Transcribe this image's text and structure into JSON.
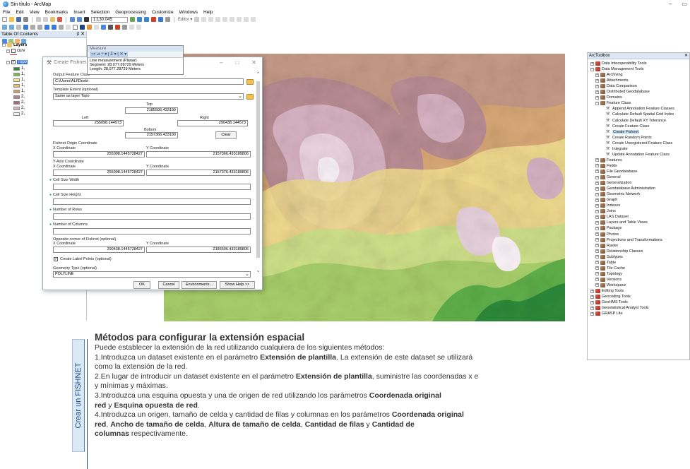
{
  "window": {
    "title": "Sin título - ArcMap",
    "controls": [
      "–",
      "▭"
    ]
  },
  "menu": [
    "File",
    "Edit",
    "View",
    "Bookmarks",
    "Insert",
    "Selection",
    "Geoprocessing",
    "Customize",
    "Windows",
    "Help"
  ],
  "toolbar": {
    "scale": "1:130.045",
    "editor_label": "Editor ▾"
  },
  "toc": {
    "title": "Table Of Contents",
    "pin": "♯",
    "close": "✕",
    "root_label": "Layers",
    "layer1_label": "curv",
    "layer2_label": "Topo",
    "class_labels": [
      "1,",
      "1,",
      "1,",
      "1,",
      "1,",
      "2,",
      "2,",
      "2,",
      "2,"
    ],
    "class_colors": [
      "#2e8b3a",
      "#7fbf4f",
      "#f0e68c",
      "#e8c26a",
      "#d4a373",
      "#b5838d",
      "#a16a7a",
      "#d7b8c6",
      "#f2f2f2"
    ]
  },
  "measure": {
    "title": "Measure",
    "tools": "⊶ ⊿ ÷ ▾ | Σ ▾ | ✕ ▾",
    "lines": [
      "Line measurement (Planar)",
      "Segment: 28,077.28729 Meters",
      "Length: 28,077.28729 Meters"
    ]
  },
  "dialog": {
    "title": "Create Fishnet",
    "win_min": "–",
    "win_max": "□",
    "win_close": "✕",
    "output_label": "Output Feature Class",
    "output_value": "C:\\Users\\ALI\\Deskt",
    "template_label": "Template Extent (optional)",
    "template_value": "Same as layer Topo",
    "top_label": "Top",
    "top_value": "2185506.433190",
    "left_label": "Left",
    "left_value": "255098.144573",
    "right_label": "Right",
    "right_value": "290438.144573",
    "bottom_label": "Bottom",
    "bottom_value": "2157366.433190",
    "clear_label": "Clear",
    "origin_label": "Fishnet Origin Coordinate",
    "x_label": "X Coordinate",
    "y_label": "Y Coordinate",
    "origin_x": "255098.1445728427",
    "origin_y": "2157366.433189806",
    "yaxis_label": "Y-Axis Coordinate",
    "yaxis_x": "255098.1445728427",
    "yaxis_y": "2157376.433189806",
    "cell_width_label": "Cell Size Width",
    "cell_height_label": "Cell Size Height",
    "rows_label": "Number of Rows",
    "cols_label": "Number of Columns",
    "opposite_label": "Opposite corner of Fishnet (optional)",
    "opposite_x": "290438.1445728427",
    "opposite_y": "2185506.433189806",
    "label_points": "Create Label Points (optional)",
    "geometry_label": "Geometry Type (optional)",
    "geometry_value": "POLYLINE",
    "ok": "OK",
    "cancel": "Cancel",
    "environments": "Environments...",
    "help": "Show Help >>"
  },
  "arctoolbox": {
    "title": "ArcToolbox",
    "items": [
      {
        "text": "Data Interoperability Tools",
        "level": 0,
        "kind": "box",
        "exp": "+"
      },
      {
        "text": "Data Management Tools",
        "level": 0,
        "kind": "box",
        "exp": "−"
      },
      {
        "text": "Archiving",
        "level": 1,
        "kind": "set",
        "exp": "+"
      },
      {
        "text": "Attachments",
        "level": 1,
        "kind": "set",
        "exp": "+"
      },
      {
        "text": "Data Comparison",
        "level": 1,
        "kind": "set",
        "exp": "+"
      },
      {
        "text": "Distributed Geodatabase",
        "level": 1,
        "kind": "set",
        "exp": "+"
      },
      {
        "text": "Domains",
        "level": 1,
        "kind": "set",
        "exp": "+"
      },
      {
        "text": "Feature Class",
        "level": 1,
        "kind": "set",
        "exp": "−"
      },
      {
        "text": "Append Annotation Feature Classes",
        "level": 2,
        "kind": "tool"
      },
      {
        "text": "Calculate Default Spatial Grid Index",
        "level": 2,
        "kind": "tool"
      },
      {
        "text": "Calculate Default XY Tolerance",
        "level": 2,
        "kind": "tool"
      },
      {
        "text": "Create Feature Class",
        "level": 2,
        "kind": "tool"
      },
      {
        "text": "Create Fishnet",
        "level": 2,
        "kind": "tool",
        "selected": true
      },
      {
        "text": "Create Random Points",
        "level": 2,
        "kind": "tool"
      },
      {
        "text": "Create Unregistered Feature Class",
        "level": 2,
        "kind": "tool"
      },
      {
        "text": "Integrate",
        "level": 2,
        "kind": "tool"
      },
      {
        "text": "Update Annotation Feature Class",
        "level": 2,
        "kind": "tool"
      },
      {
        "text": "Features",
        "level": 1,
        "kind": "set",
        "exp": "+"
      },
      {
        "text": "Fields",
        "level": 1,
        "kind": "set",
        "exp": "+"
      },
      {
        "text": "File Geodatabase",
        "level": 1,
        "kind": "set",
        "exp": "+"
      },
      {
        "text": "General",
        "level": 1,
        "kind": "set",
        "exp": "+"
      },
      {
        "text": "Generalization",
        "level": 1,
        "kind": "set",
        "exp": "+"
      },
      {
        "text": "Geodatabase Administration",
        "level": 1,
        "kind": "set",
        "exp": "+"
      },
      {
        "text": "Geometric Network",
        "level": 1,
        "kind": "set",
        "exp": "+"
      },
      {
        "text": "Graph",
        "level": 1,
        "kind": "set",
        "exp": "+"
      },
      {
        "text": "Indexes",
        "level": 1,
        "kind": "set",
        "exp": "+"
      },
      {
        "text": "Joins",
        "level": 1,
        "kind": "set",
        "exp": "+"
      },
      {
        "text": "LAS Dataset",
        "level": 1,
        "kind": "set",
        "exp": "+"
      },
      {
        "text": "Layers and Table Views",
        "level": 1,
        "kind": "set",
        "exp": "+"
      },
      {
        "text": "Package",
        "level": 1,
        "kind": "set",
        "exp": "+"
      },
      {
        "text": "Photos",
        "level": 1,
        "kind": "set",
        "exp": "+"
      },
      {
        "text": "Projections and Transformations",
        "level": 1,
        "kind": "set",
        "exp": "+"
      },
      {
        "text": "Raster",
        "level": 1,
        "kind": "set",
        "exp": "+"
      },
      {
        "text": "Relationship Classes",
        "level": 1,
        "kind": "set",
        "exp": "+"
      },
      {
        "text": "Subtypes",
        "level": 1,
        "kind": "set",
        "exp": "+"
      },
      {
        "text": "Table",
        "level": 1,
        "kind": "set",
        "exp": "+"
      },
      {
        "text": "Tile Cache",
        "level": 1,
        "kind": "set",
        "exp": "+"
      },
      {
        "text": "Topology",
        "level": 1,
        "kind": "set",
        "exp": "+"
      },
      {
        "text": "Versions",
        "level": 1,
        "kind": "set",
        "exp": "+"
      },
      {
        "text": "Workspace",
        "level": 1,
        "kind": "set",
        "exp": "+"
      },
      {
        "text": "Editing Tools",
        "level": 0,
        "kind": "box",
        "exp": "+"
      },
      {
        "text": "Geocoding Tools",
        "level": 0,
        "kind": "box",
        "exp": "+"
      },
      {
        "text": "GeoHMS Tools",
        "level": 0,
        "kind": "box",
        "exp": "+"
      },
      {
        "text": "Geostatistical Analyst Tools",
        "level": 0,
        "kind": "box",
        "exp": "+"
      },
      {
        "text": "GRASP Lite",
        "level": 0,
        "kind": "box",
        "exp": "+"
      }
    ]
  },
  "annotation": {
    "side_label": "Crear un FISHNET",
    "title": "Métodos para configurar la extensión espacial",
    "intro": "Puede establecer la extensión de la red utilizando cualquiera de los siguientes métodos:",
    "m1a": "1.Introduzca un dataset existente en el parámetro ",
    "m1b": "Extensión de plantilla",
    "m1c": ". La extensión de este dataset se utilizará",
    "m1d": "como la extensión de la red.",
    "m2a": "2.En lugar de introducir un dataset existente en el parámetro ",
    "m2b": "Extensión de plantilla",
    "m2c": ", suministre las coordenadas x e",
    "m2d": "y mínimas y máximas.",
    "m3a": "3.Introduzca una esquina opuesta y una de origen de red utilizando los parámetros ",
    "m3b": "Coordenada original",
    "m3c": "red",
    "m3d": " y ",
    "m3e": "Esquina opuesta de red",
    "m3f": ".",
    "m4a": "4.Introduzca un origen, tamaño de celda y cantidad de filas y columnas en los parámetros ",
    "m4b": "Coordenada original",
    "m4c": "red",
    "m4d": ", ",
    "m4e": "Ancho de tamaño de celda",
    "m4f": ", ",
    "m4g": "Altura de tamaño de celda",
    "m4h": ", ",
    "m4i": "Cantidad de filas",
    "m4j": " y ",
    "m4k": "Cantidad de",
    "m4l": "columnas",
    "m4m": " respectivamente."
  }
}
